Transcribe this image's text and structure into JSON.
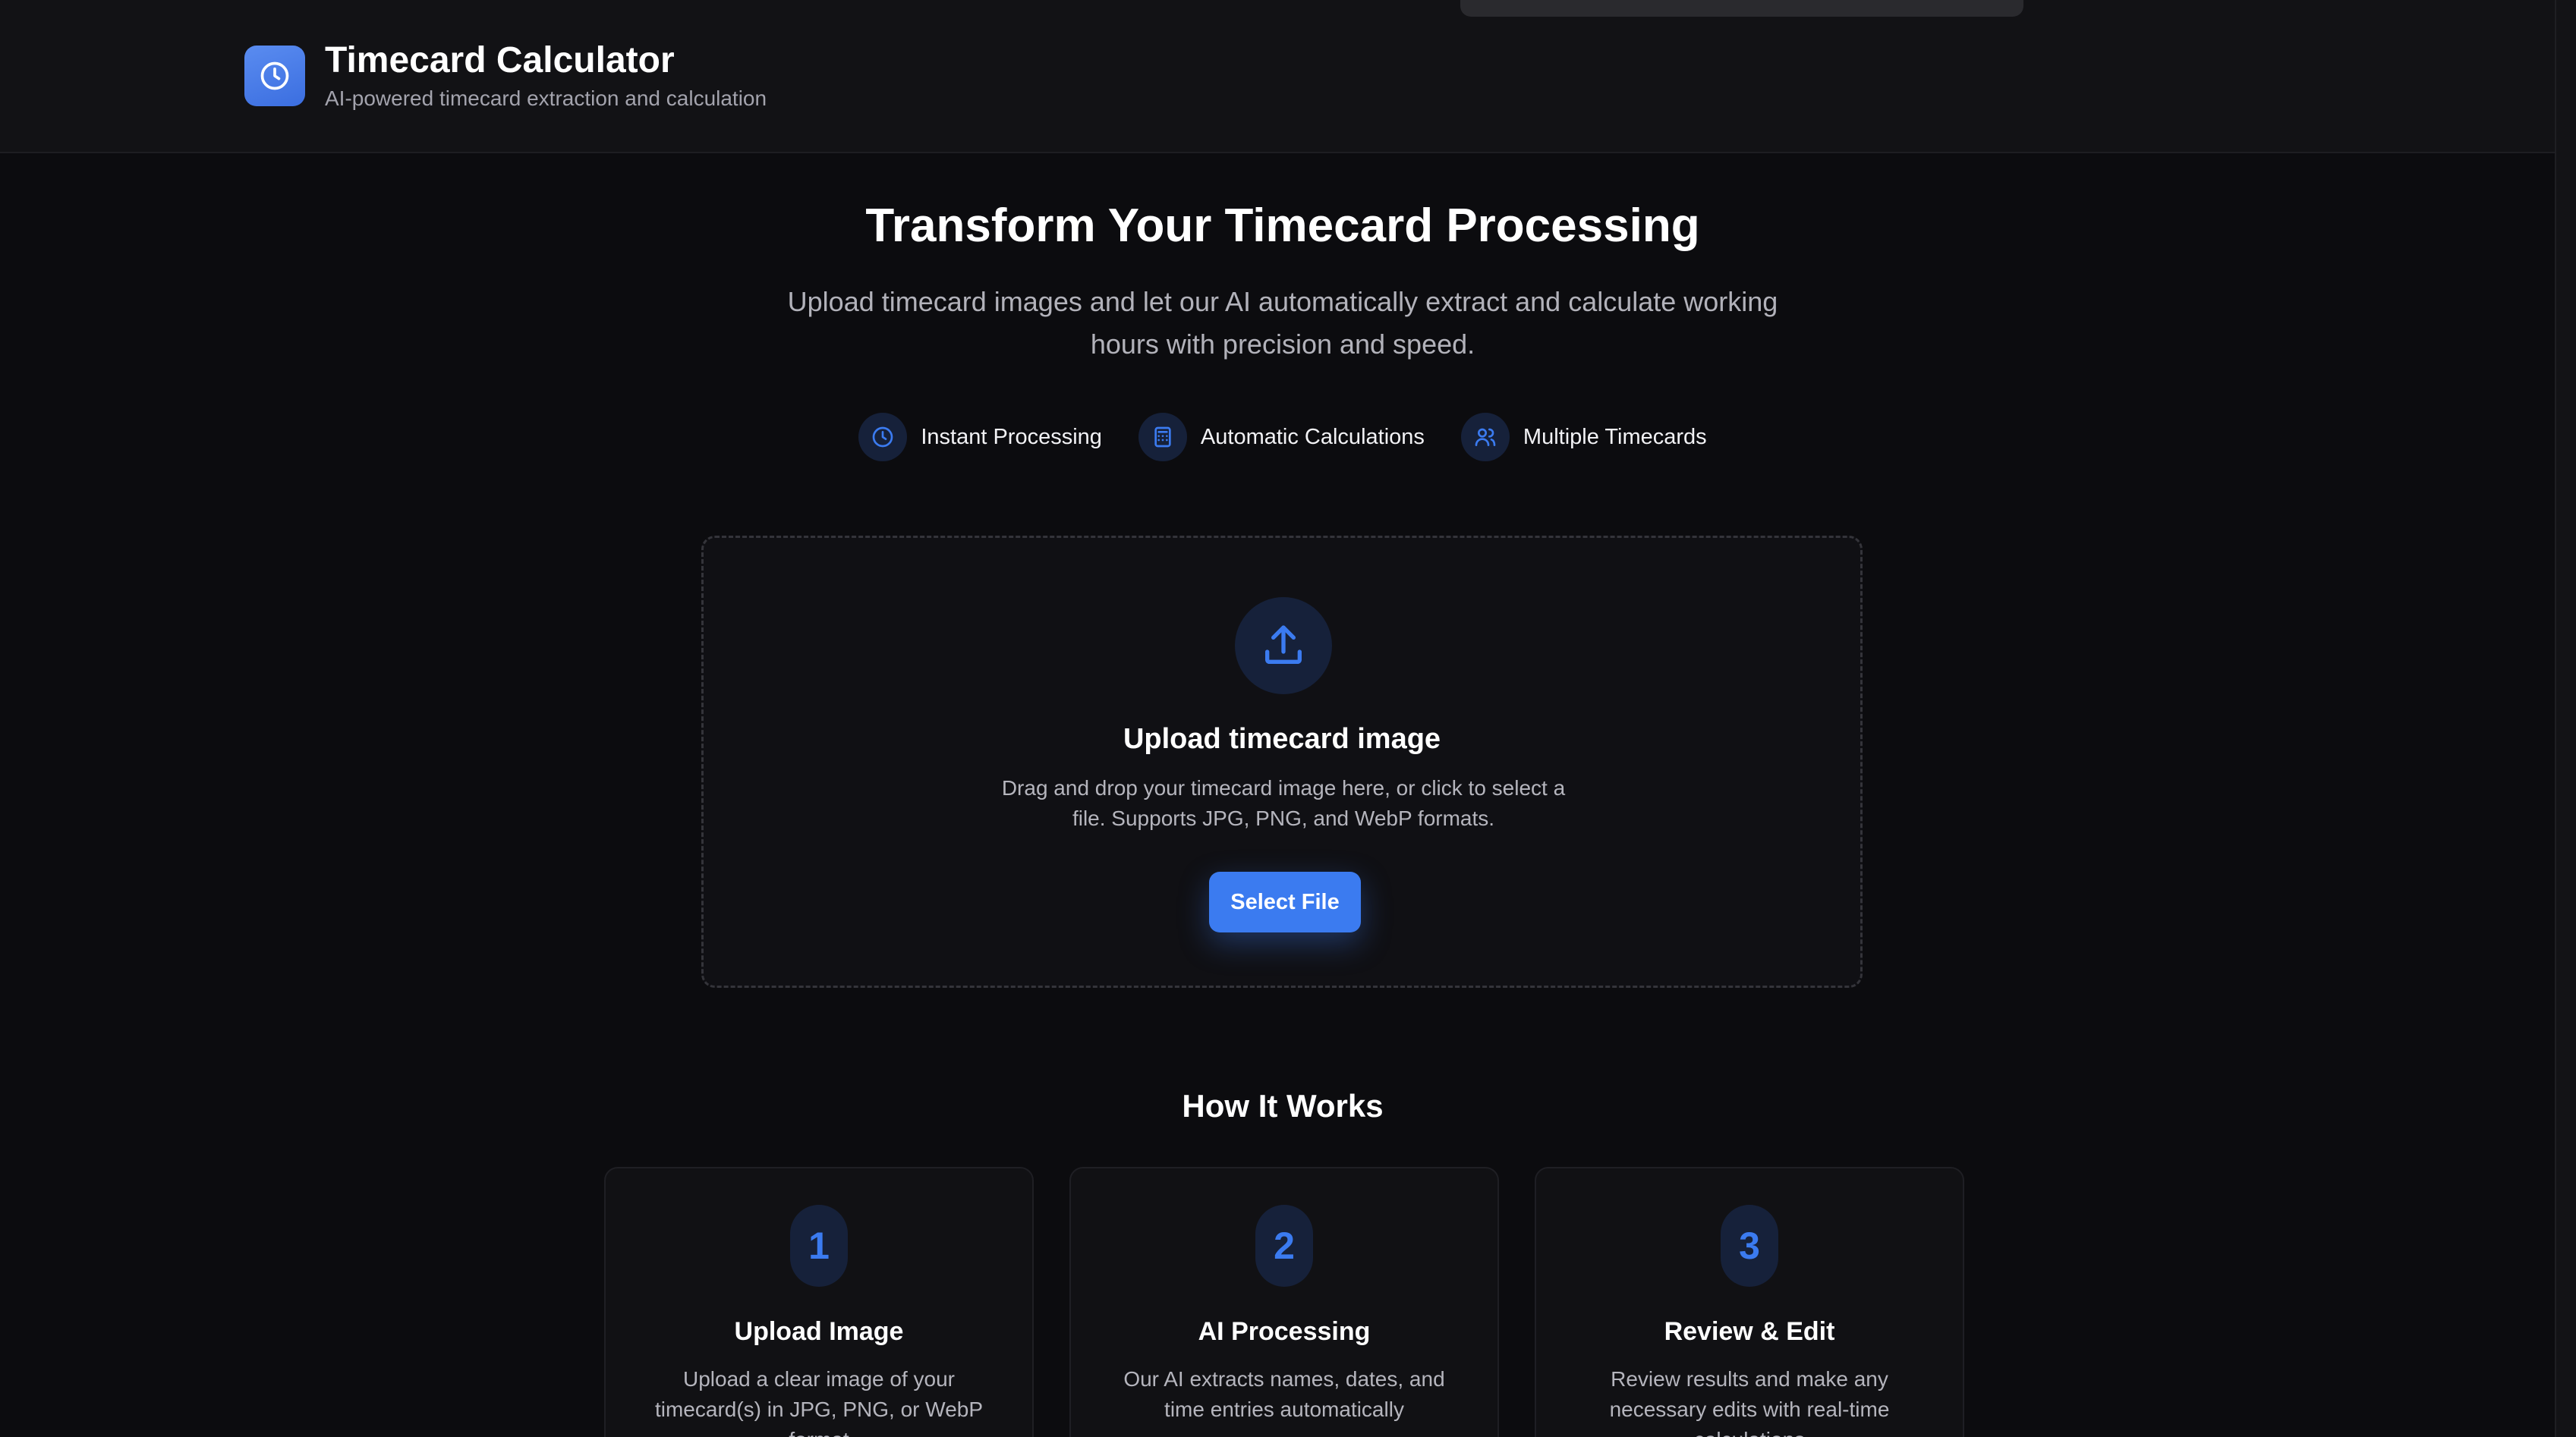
{
  "header": {
    "app_title": "Timecard Calculator",
    "app_subtitle": "AI-powered timecard extraction and calculation",
    "logo_icon": "clock-icon"
  },
  "hero": {
    "title": "Transform Your Timecard Processing",
    "description": "Upload timecard images and let our AI automatically extract and calculate working hours with precision and speed."
  },
  "features": [
    {
      "label": "Instant Processing",
      "icon": "clock-icon"
    },
    {
      "label": "Automatic Calculations",
      "icon": "calculator-icon"
    },
    {
      "label": "Multiple Timecards",
      "icon": "users-icon"
    }
  ],
  "upload": {
    "icon": "upload-icon",
    "title": "Upload timecard image",
    "description": "Drag and drop your timecard image here, or click to select a file. Supports JPG, PNG, and WebP formats.",
    "button_label": "Select File"
  },
  "how_it_works": {
    "title": "How It Works",
    "steps": [
      {
        "number": "1",
        "title": "Upload Image",
        "description": "Upload a clear image of your timecard(s) in JPG, PNG, or WebP format"
      },
      {
        "number": "2",
        "title": "AI Processing",
        "description": "Our AI extracts names, dates, and time entries automatically"
      },
      {
        "number": "3",
        "title": "Review & Edit",
        "description": "Review results and make any necessary edits with real-time calculations"
      }
    ]
  },
  "colors": {
    "accent": "#3b7bf0",
    "background": "#0c0c0f",
    "header_bg": "#121215",
    "muted_text": "#b5b5bd"
  }
}
